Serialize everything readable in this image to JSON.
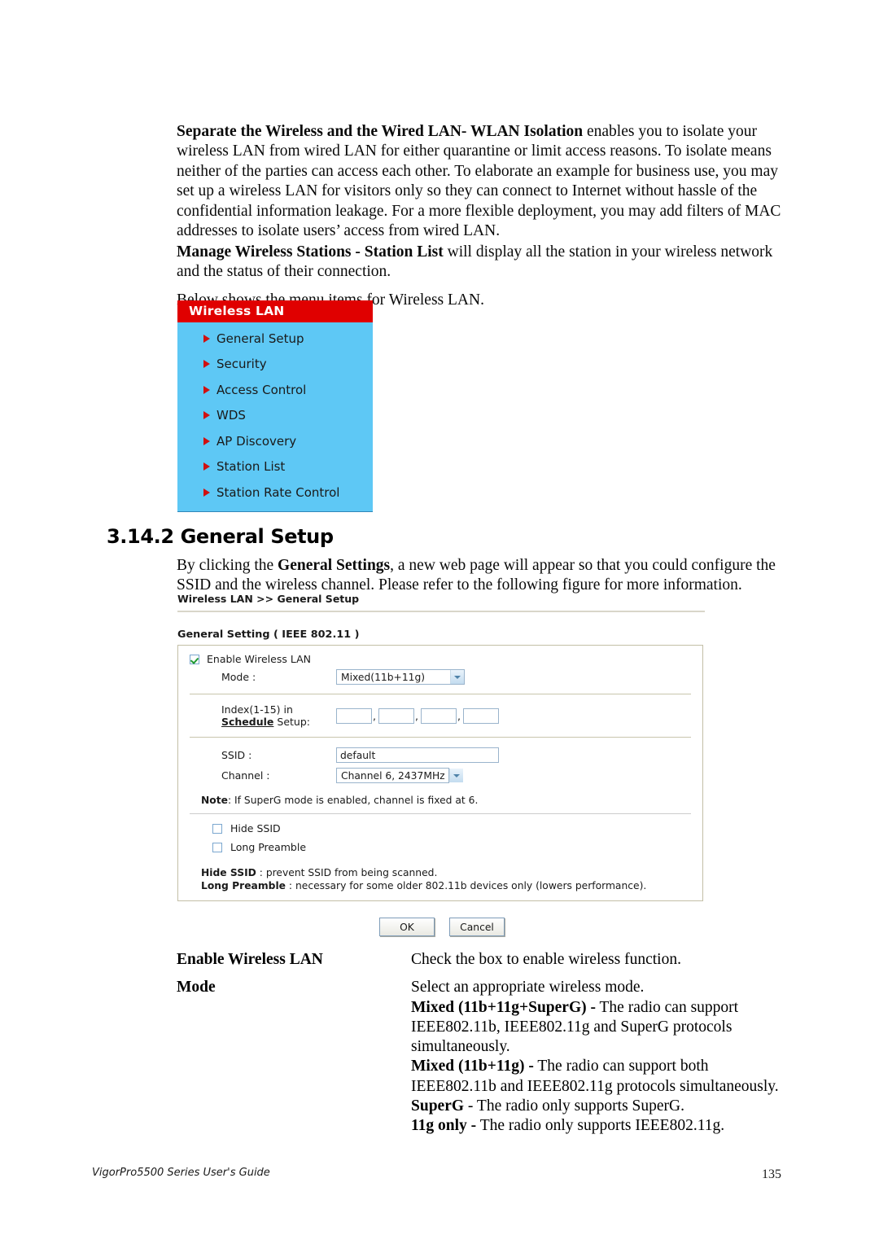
{
  "document": {
    "footer_title": "VigorPro5500 Series User's Guide",
    "page_number": "135"
  },
  "paragraphs": {
    "isolation_bold": "Separate the Wireless and the Wired LAN- WLAN Isolation",
    "isolation_rest": " enables you to isolate your wireless LAN from wired LAN for either quarantine or limit access reasons. To isolate means neither of the parties can access each other. To elaborate an example for business use, you may set up a wireless LAN for visitors only so they can connect to Internet without hassle of the confidential information leakage. For a more flexible deployment, you may add filters of MAC addresses to isolate users’ access from wired LAN.",
    "stations_bold": "Manage Wireless Stations - Station List",
    "stations_rest": " will display all the station in your wireless network and the status of their connection.",
    "below_menu": "Below shows the menu items for Wireless LAN.",
    "general_settings_pre": "By clicking the ",
    "general_settings_bold": "General Settings",
    "general_settings_post": ", a new web page will appear so that you could configure the SSID and the wireless channel. Please refer to the following figure for more information."
  },
  "section": {
    "number": "3.14.2",
    "title": "General Setup",
    "heading": "3.14.2 General Setup"
  },
  "wlan_menu": {
    "header": "Wireless LAN",
    "header_color": "#e00000",
    "body_color": "#5ec8f5",
    "bullet_color": "#d01010",
    "items": [
      {
        "label": "General Setup"
      },
      {
        "label": "Security"
      },
      {
        "label": "Access Control"
      },
      {
        "label": "WDS"
      },
      {
        "label": "AP Discovery"
      },
      {
        "label": "Station List"
      },
      {
        "label": "Station Rate Control"
      }
    ]
  },
  "router_ui": {
    "breadcrumb": "Wireless LAN >> General Setup",
    "section_title": "General Setting ( IEEE 802.11 )",
    "enable_wireless_lan": {
      "label": "Enable Wireless LAN",
      "checked": "true"
    },
    "mode": {
      "label": "Mode :",
      "value": "Mixed(11b+11g)"
    },
    "schedule": {
      "label_line1": "Index(1-15) in",
      "label_schedule": "Schedule",
      "label_line2_suffix": " Setup:",
      "values": [
        "",
        "",
        "",
        ""
      ],
      "separator": ","
    },
    "ssid": {
      "label": "SSID :",
      "value": "default"
    },
    "channel": {
      "label": "Channel :",
      "value": "Channel 6, 2437MHz"
    },
    "note": {
      "prefix": "Note",
      "text": ": If SuperG mode is enabled, channel is fixed at 6."
    },
    "hide_ssid": {
      "label": "Hide SSID",
      "checked": "false"
    },
    "long_preamble": {
      "label": "Long Preamble",
      "checked": "false"
    },
    "help": {
      "hide_ssid_term": "Hide SSID",
      "hide_ssid_desc": " : prevent SSID from being scanned.",
      "long_preamble_term": "Long Preamble",
      "long_preamble_desc": " : necessary for some older 802.11b devices only (lowers performance)."
    },
    "buttons": {
      "ok": "OK",
      "cancel": "Cancel"
    }
  },
  "definitions": [
    {
      "term": "Enable Wireless LAN",
      "lines": [
        {
          "text": "Check the box to enable wireless function."
        }
      ]
    },
    {
      "term": "Mode",
      "lines": [
        {
          "text": "Select an appropriate wireless mode."
        },
        {
          "bold": "Mixed (11b+11g+SuperG) -",
          "text": " The radio can support"
        },
        {
          "text": "IEEE802.11b, IEEE802.11g and SuperG protocols"
        },
        {
          "text": "simultaneously."
        },
        {
          "bold": "Mixed (11b+11g) -",
          "text": " The radio can support both"
        },
        {
          "text": "IEEE802.11b and IEEE802.11g protocols simultaneously."
        },
        {
          "bold": "SuperG",
          "text": " - The radio only supports SuperG."
        },
        {
          "bold": "11g only -",
          "text": " The radio only supports IEEE802.11g."
        }
      ]
    }
  ]
}
